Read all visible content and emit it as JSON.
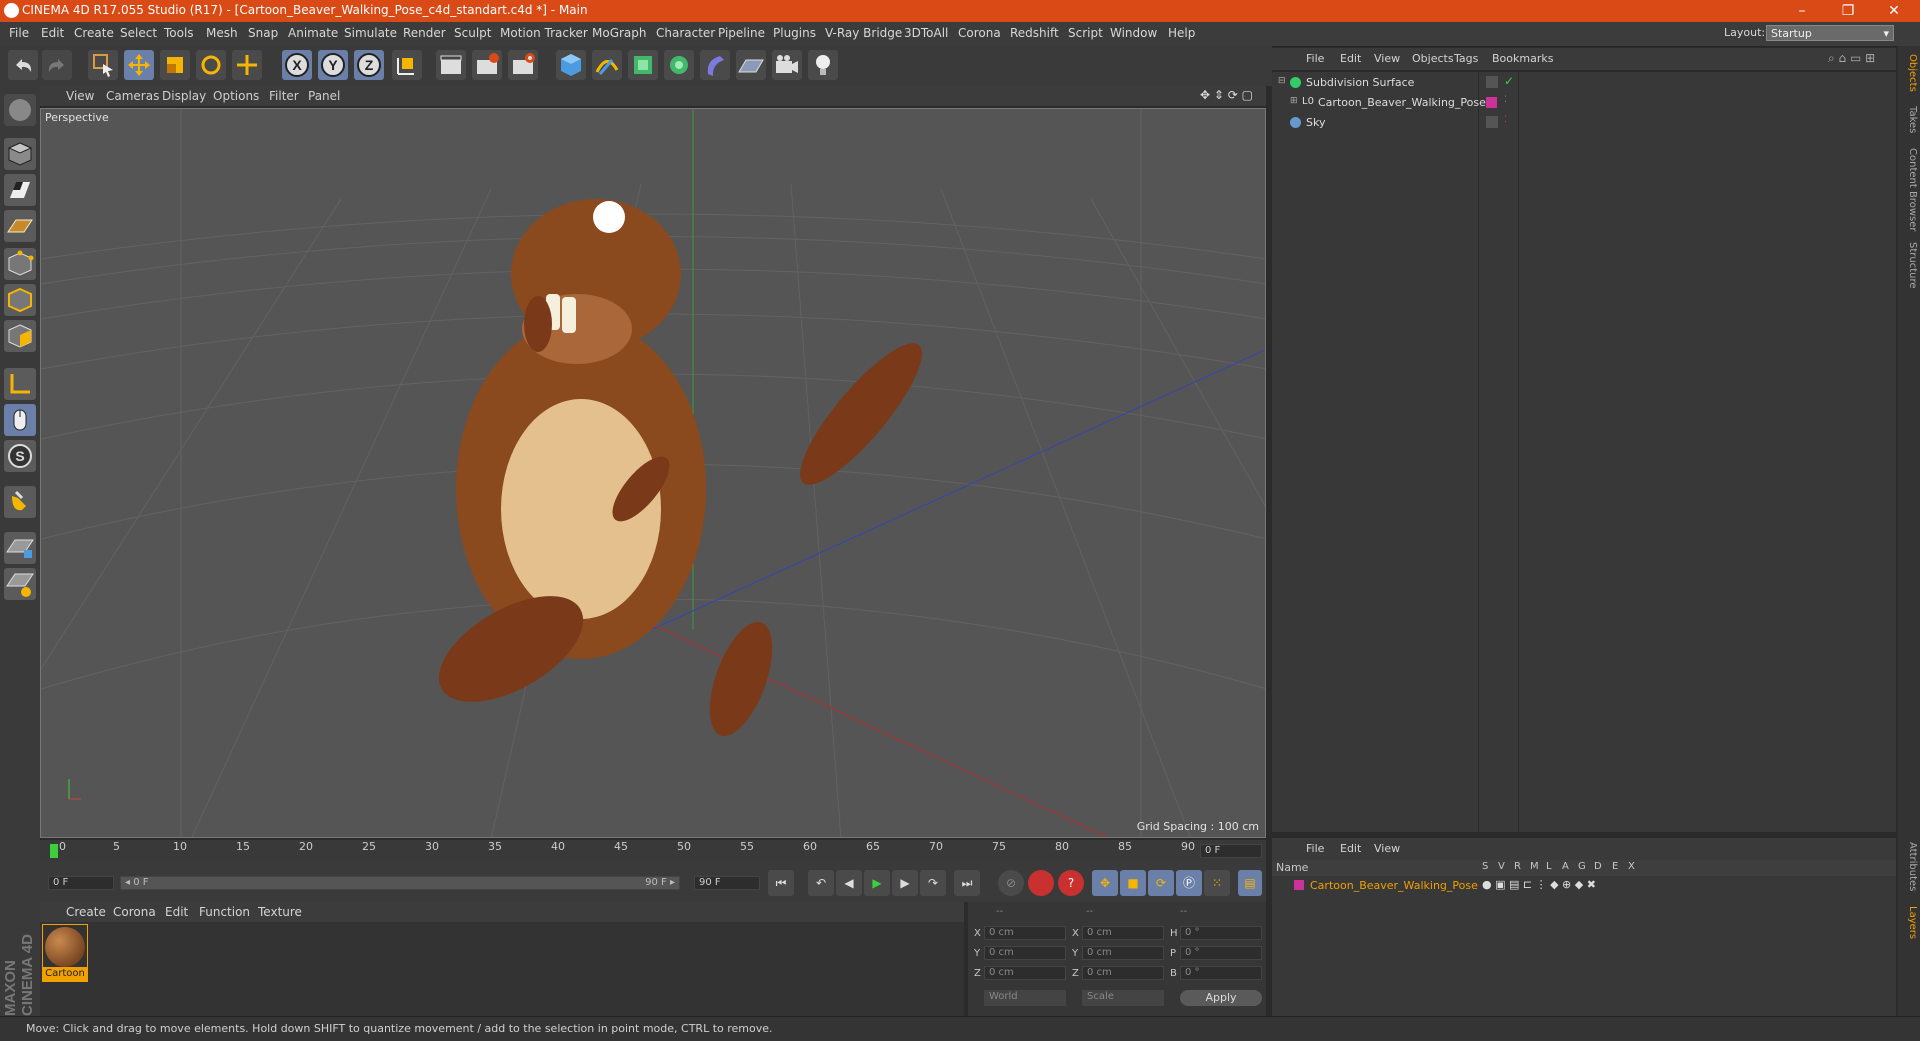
{
  "window": {
    "title": "CINEMA 4D R17.055 Studio (R17) - [Cartoon_Beaver_Walking_Pose_c4d_standart.c4d *] - Main",
    "minimize": "–",
    "maximize": "❐",
    "close": "✕"
  },
  "menubar": {
    "items": [
      "File",
      "Edit",
      "Create",
      "Select",
      "Tools",
      "Mesh",
      "Snap",
      "Animate",
      "Simulate",
      "Render",
      "Sculpt",
      "Motion Tracker",
      "MoGraph",
      "Character",
      "Pipeline",
      "Plugins",
      "V-Ray Bridge",
      "3DToAll",
      "Corona",
      "Redshift",
      "Script",
      "Window",
      "Help"
    ],
    "layout_label": "Layout:",
    "layout_value": "Startup"
  },
  "toolbar": {
    "axis_x": "X",
    "axis_y": "Y",
    "axis_z": "Z"
  },
  "viewport": {
    "menu": [
      "View",
      "Cameras",
      "Display",
      "Options",
      "Filter",
      "Panel"
    ],
    "camera_label": "Perspective",
    "grid_spacing": "Grid Spacing : 100 cm"
  },
  "timeline": {
    "ticks": [
      "0",
      "5",
      "10",
      "15",
      "20",
      "25",
      "30",
      "35",
      "40",
      "45",
      "50",
      "55",
      "60",
      "65",
      "70",
      "75",
      "80",
      "85",
      "90"
    ],
    "current_frame": "0 F",
    "start_frame": "0 F",
    "range_start": "◂ 0 F",
    "range_end": "90 F ▸",
    "end_frame": "90 F"
  },
  "material_manager": {
    "menu": [
      "Create",
      "Corona",
      "Edit",
      "Function",
      "Texture"
    ],
    "material_name": "Cartoon"
  },
  "coordinates": {
    "header": [
      "--",
      "--",
      "--"
    ],
    "rows": [
      {
        "a": "X",
        "av": "0 cm",
        "b": "X",
        "bv": "0 cm",
        "c": "H",
        "cv": "0 °"
      },
      {
        "a": "Y",
        "av": "0 cm",
        "b": "Y",
        "bv": "0 cm",
        "c": "P",
        "cv": "0 °"
      },
      {
        "a": "Z",
        "av": "0 cm",
        "b": "Z",
        "bv": "0 cm",
        "c": "B",
        "cv": "0 °"
      }
    ],
    "mode_world": "World",
    "mode_scale": "Scale",
    "apply": "Apply"
  },
  "object_manager": {
    "menu": [
      "File",
      "Edit",
      "View",
      "Objects",
      "Tags",
      "Bookmarks"
    ],
    "objects": [
      {
        "name": "Subdivision Surface",
        "color": "#33cc66"
      },
      {
        "name": "Cartoon_Beaver_Walking_Pose",
        "color": "#cc3399"
      },
      {
        "name": "Sky",
        "color": "#6699cc"
      }
    ]
  },
  "layer_manager": {
    "menu": [
      "File",
      "Edit",
      "View"
    ],
    "columns": [
      "Name",
      "S",
      "V",
      "R",
      "M",
      "L",
      "A",
      "G",
      "D",
      "E",
      "X"
    ],
    "row_name": "Cartoon_Beaver_Walking_Pose"
  },
  "side_tabs": [
    "Objects",
    "Takes",
    "Content Browser",
    "Structure",
    "Attributes",
    "Layers"
  ],
  "status": "Move: Click and drag to move elements. Hold down SHIFT to quantize movement / add to the selection in point mode, CTRL to remove.",
  "brand": "MAXON CINEMA 4D",
  "colors": {
    "accent": "#d94a16",
    "selection": "#f0a000"
  }
}
